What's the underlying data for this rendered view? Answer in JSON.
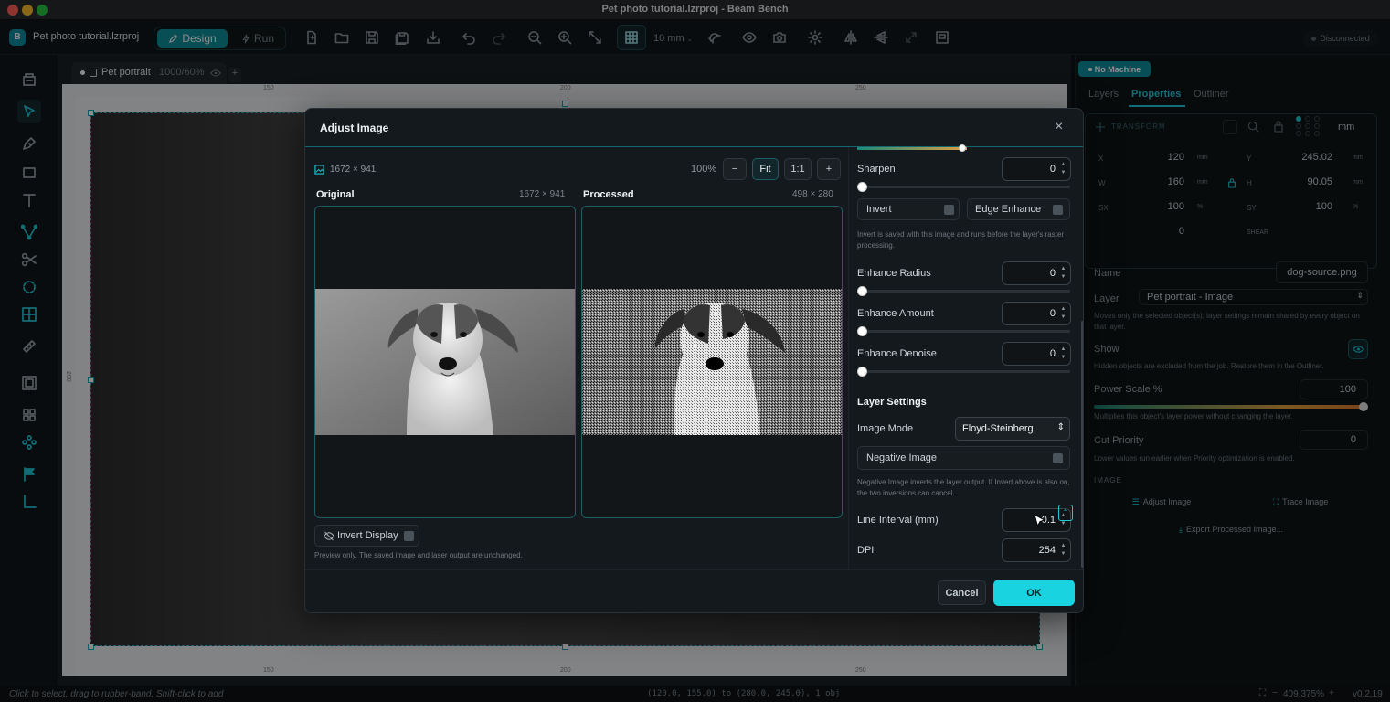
{
  "window": {
    "title": "Pet photo tutorial.lzrproj - Beam Bench"
  },
  "toolbar": {
    "app_badge": "B",
    "project_name": "Pet photo tutorial.lzrproj",
    "design_label": "Design",
    "run_label": "Run",
    "grid_size": "10 mm",
    "connection_status": "Disconnected"
  },
  "doc_tab": {
    "name": "Pet portrait",
    "meta": "1000/60%"
  },
  "ruler": {
    "top_ticks": [
      "150",
      "200",
      "250"
    ],
    "bottom_ticks": [
      "150",
      "200",
      "250"
    ],
    "left_tick": "200"
  },
  "status": {
    "hint": "Click to select, drag to rubber-band, Shift-click to add",
    "selection": "(120.0, 155.0) to (280.0, 245.0), 1 obj",
    "zoom": "409.375%",
    "version": "v0.2.19"
  },
  "right_panel": {
    "machine_badge": "No Machine",
    "tabs": [
      "Layers",
      "Properties",
      "Outliner"
    ],
    "transform": {
      "title": "TRANSFORM",
      "unit": "mm",
      "x_label": "X",
      "x": "120",
      "y_label": "Y",
      "y": "245.02",
      "w_label": "W",
      "w": "160",
      "h_label": "H",
      "h": "90.05",
      "sx_label": "SX",
      "sx": "100",
      "sy_label": "SY",
      "sy": "100",
      "rot": "0",
      "shear_label": "SHEAR",
      "mm": "mm",
      "pct": "%"
    },
    "name_label": "Name",
    "name_value": "dog-source.png",
    "layer_label": "Layer",
    "layer_value": "Pet portrait - Image",
    "layer_help": "Moves only the selected object(s); layer settings remain shared by every object on that layer.",
    "show_label": "Show",
    "show_help": "Hidden objects are excluded from the job. Restore them in the Outliner.",
    "power_label": "Power Scale %",
    "power_value": "100",
    "power_fraction": 1.0,
    "power_help": "Multiplies this object's layer power without changing the layer.",
    "cut_label": "Cut Priority",
    "cut_value": "0",
    "cut_help": "Lower values run earlier when Priority optimization is enabled.",
    "image_section": "IMAGE",
    "adjust_btn": "Adjust Image",
    "trace_btn": "Trace Image",
    "export_btn": "Export Processed Image..."
  },
  "modal": {
    "title": "Adjust Image",
    "image_dims": "1672 × 941",
    "zoom": "100%",
    "fit_label": "Fit",
    "one_to_one": "1:1",
    "minus": "−",
    "plus": "+",
    "original_label": "Original",
    "original_dims": "1672 × 941",
    "processed_label": "Processed",
    "processed_dims": "498 × 280",
    "invert_display_label": "Invert Display",
    "preview_note": "Preview only. The saved image and laser output are unchanged.",
    "sharpen_label": "Sharpen",
    "sharpen_value": "0",
    "invert_label": "Invert",
    "edge_enhance_label": "Edge Enhance",
    "invert_note": "Invert is saved with this image and runs before the layer's raster processing.",
    "enhance_radius_label": "Enhance Radius",
    "enhance_radius_value": "0",
    "enhance_amount_label": "Enhance Amount",
    "enhance_amount_value": "0",
    "enhance_denoise_label": "Enhance Denoise",
    "enhance_denoise_value": "0",
    "layer_settings_title": "Layer Settings",
    "image_mode_label": "Image Mode",
    "image_mode_value": "Floyd-Steinberg",
    "negative_image_label": "Negative Image",
    "negative_note": "Negative Image inverts the layer output. If Invert above is also on, the two inversions can cancel.",
    "line_interval_label": "Line Interval (mm)",
    "line_interval_value": "0.1",
    "dpi_label": "DPI",
    "dpi_value": "254",
    "cancel_label": "Cancel",
    "ok_label": "OK",
    "close_glyph": "×"
  },
  "colors": {
    "accent": "#14b8c8",
    "ok": "#19d3e0",
    "bg": "#0d1114"
  }
}
